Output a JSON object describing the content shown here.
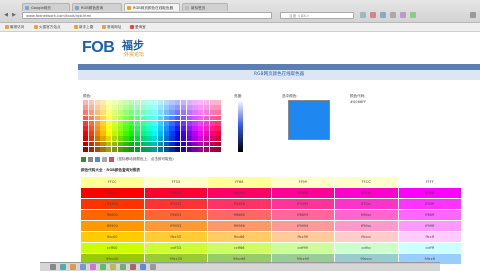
{
  "browser": {
    "tabs": [
      {
        "label": "Google网页"
      },
      {
        "label": "RGB颜色查询"
      },
      {
        "label": "RGB网页颜色在线取色器"
      },
      {
        "label": "新标签页"
      }
    ],
    "address": "www.fodnetwork.com/tools/rgb.html",
    "search_placeholder": "百度 <⌘K>",
    "bookmarks": [
      {
        "label": "最常访问"
      },
      {
        "label": "火狐官方站点"
      },
      {
        "label": "新手上路"
      },
      {
        "label": "常用网址"
      },
      {
        "label": "爱淘宝"
      }
    ]
  },
  "logo": {
    "text": "FOB",
    "sub": "福步",
    "tag": "外贸论坛"
  },
  "page": {
    "title": "RGB网页颜色在线取色器",
    "label_palette": "颜色:",
    "label_brightness": "亮度:",
    "label_selected": "选中颜色:",
    "label_code": "颜色代码:",
    "selected_hex": "#0066FF",
    "tool_hint": "(鼠标移动到颜色上，点击即可取色)",
    "table_heading": "颜色代码大全 · RGB颜色查询对照表",
    "accent": "#1e88f0",
    "table_header": [
      "FFCC",
      "FF33",
      "FF66",
      "FF99",
      "FFCC",
      "FFFF"
    ],
    "table_rows": [
      [
        "ff0000",
        "ff0033",
        "ff0066",
        "ff0099",
        "ff00cc",
        "ff00ff"
      ],
      [
        "ff3300",
        "ff3333",
        "ff3366",
        "ff3399",
        "ff33cc",
        "ff33ff"
      ],
      [
        "ff6600",
        "ff6633",
        "ff6666",
        "ff6699",
        "ff66cc",
        "ff66ff"
      ],
      [
        "ff9900",
        "ff9933",
        "ff9966",
        "ff9999",
        "ff99cc",
        "ff99ff"
      ],
      [
        "ffcc00",
        "ffcc33",
        "ffcc66",
        "ffcc99",
        "ffcccc",
        "ffccff"
      ],
      [
        "ccff00",
        "ccff33",
        "ccff66",
        "ccff99",
        "ccffcc",
        "ccffff"
      ],
      [
        "99cc00",
        "99cc33",
        "99cc66",
        "99cc99",
        "99cccc",
        "99ccff"
      ]
    ]
  }
}
